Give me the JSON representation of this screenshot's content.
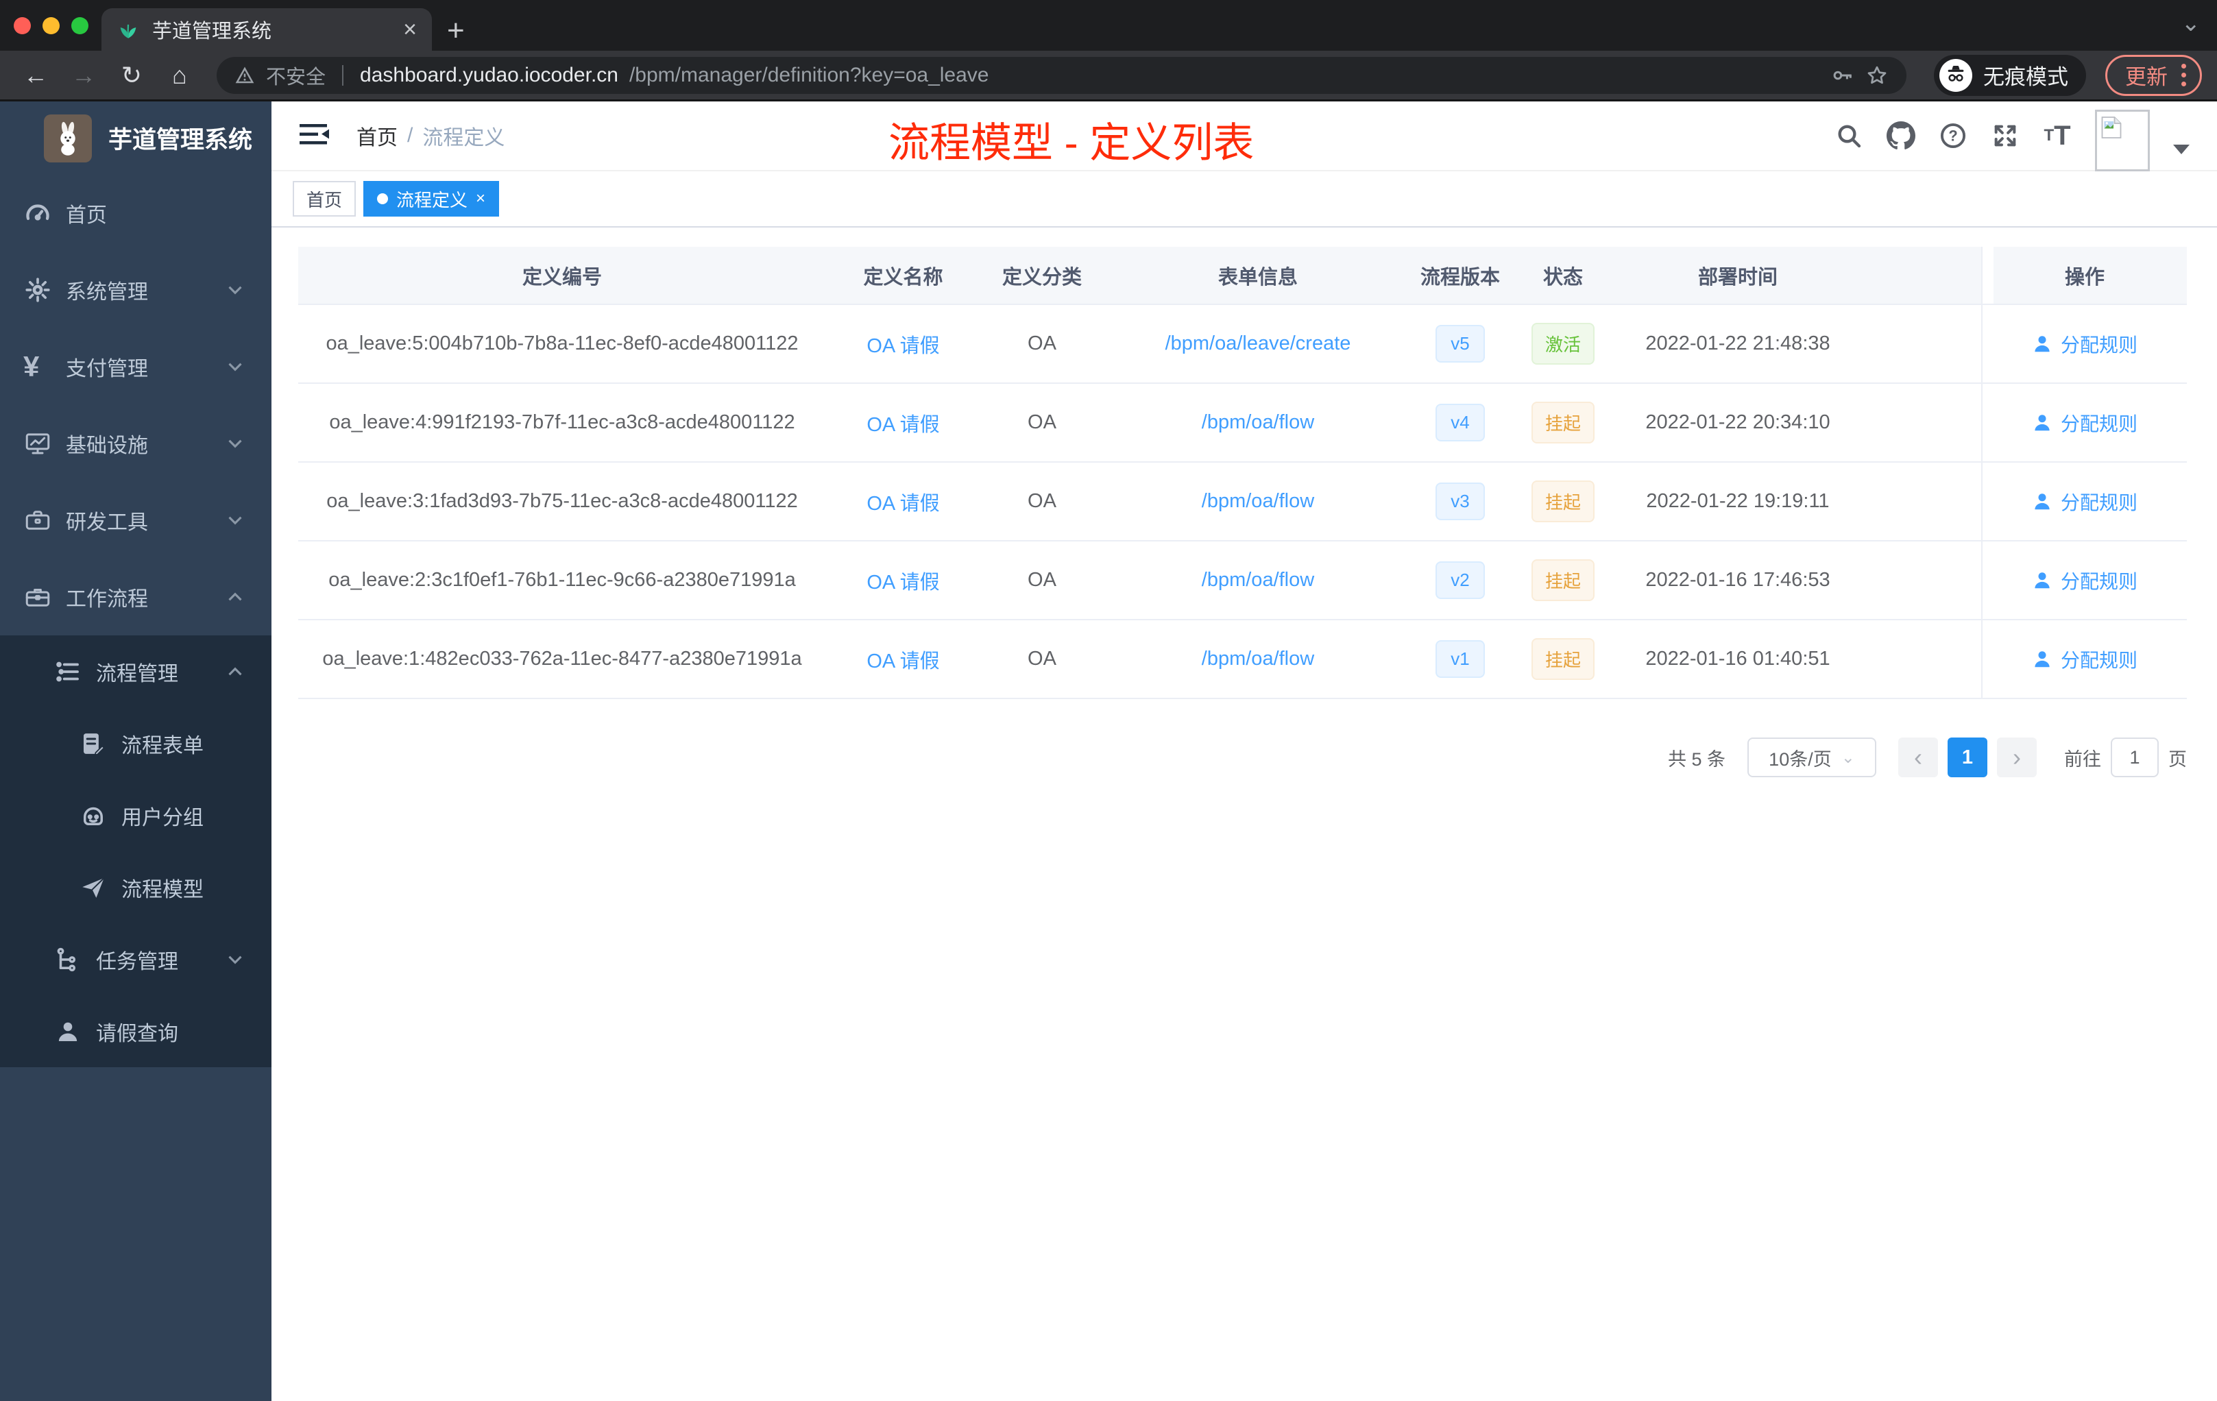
{
  "colors": {
    "primary_link": "#409eff",
    "active_tag": "#2190f0",
    "success": "#67c23a",
    "warning": "#e6a23c",
    "annotation_red": "#fe2c0a",
    "sidebar_bg": "#304156",
    "sidebar_submenu_bg": "#1f2d3d",
    "update_button": "#f28b82",
    "traffic_red": "#ff5f57",
    "traffic_yellow": "#febc2e",
    "traffic_green": "#28c840"
  },
  "icons": {
    "back": "←",
    "forward": "→",
    "reload": "↻",
    "home": "⌂",
    "close": "×",
    "plus": "+",
    "tab_search_caret": "⌄",
    "yen": "¥",
    "help": "?",
    "size_small": "T",
    "size_large": "T",
    "chevron_left": "‹",
    "chevron_right": "›",
    "select_caret": "⌄"
  },
  "browser": {
    "tab_title": "芋道管理系统",
    "security_label": "不安全",
    "url_host": "dashboard.yudao.iocoder.cn",
    "url_path": "/bpm/manager/definition?key=oa_leave",
    "incognito_label": "无痕模式",
    "update_label": "更新"
  },
  "sidebar": {
    "title": "芋道管理系统",
    "items": [
      {
        "label": "首页",
        "icon": "dashboard-icon"
      },
      {
        "label": "系统管理",
        "icon": "gear-icon",
        "chevron": "down"
      },
      {
        "label": "支付管理",
        "icon": "yen-icon",
        "chevron": "down"
      },
      {
        "label": "基础设施",
        "icon": "monitor-icon",
        "chevron": "down"
      },
      {
        "label": "研发工具",
        "icon": "toolbox-icon",
        "chevron": "down"
      },
      {
        "label": "工作流程",
        "icon": "briefcase-icon",
        "chevron": "up"
      },
      {
        "label": "流程管理",
        "icon": "list-tree-icon",
        "chevron": "up",
        "level": 2
      },
      {
        "label": "流程表单",
        "icon": "form-doc-icon",
        "level": 3
      },
      {
        "label": "用户分组",
        "icon": "robot-icon",
        "level": 3
      },
      {
        "label": "流程模型",
        "icon": "paper-plane-icon",
        "level": 3
      },
      {
        "label": "任务管理",
        "icon": "tree-icon",
        "chevron": "down",
        "level": 2
      },
      {
        "label": "请假查询",
        "icon": "person-icon",
        "level": 2
      }
    ]
  },
  "navbar": {
    "breadcrumb": {
      "home": "首页",
      "separator": "/",
      "current": "流程定义"
    },
    "annotation": "流程模型 - 定义列表"
  },
  "tags": [
    {
      "label": "首页",
      "active": false
    },
    {
      "label": "流程定义",
      "active": true
    }
  ],
  "table": {
    "headers": [
      "定义编号",
      "定义名称",
      "定义分类",
      "表单信息",
      "流程版本",
      "状态",
      "部署时间",
      "操作"
    ],
    "action_label": "分配规则",
    "rows": [
      {
        "id": "oa_leave:5:004b710b-7b8a-11ec-8ef0-acde48001122",
        "name": "OA 请假",
        "category": "OA",
        "form": "/bpm/oa/leave/create",
        "version": "v5",
        "status": "激活",
        "status_type": "success",
        "time": "2022-01-22 21:48:38",
        "action": "分配规则"
      },
      {
        "id": "oa_leave:4:991f2193-7b7f-11ec-a3c8-acde48001122",
        "name": "OA 请假",
        "category": "OA",
        "form": "/bpm/oa/flow",
        "version": "v4",
        "status": "挂起",
        "status_type": "warning",
        "time": "2022-01-22 20:34:10",
        "action": "分配规则"
      },
      {
        "id": "oa_leave:3:1fad3d93-7b75-11ec-a3c8-acde48001122",
        "name": "OA 请假",
        "category": "OA",
        "form": "/bpm/oa/flow",
        "version": "v3",
        "status": "挂起",
        "status_type": "warning",
        "time": "2022-01-22 19:19:11",
        "action": "分配规则"
      },
      {
        "id": "oa_leave:2:3c1f0ef1-76b1-11ec-9c66-a2380e71991a",
        "name": "OA 请假",
        "category": "OA",
        "form": "/bpm/oa/flow",
        "version": "v2",
        "status": "挂起",
        "status_type": "warning",
        "time": "2022-01-16 17:46:53",
        "action": "分配规则"
      },
      {
        "id": "oa_leave:1:482ec033-762a-11ec-8477-a2380e71991a",
        "name": "OA 请假",
        "category": "OA",
        "form": "/bpm/oa/flow",
        "version": "v1",
        "status": "挂起",
        "status_type": "warning",
        "time": "2022-01-16 01:40:51",
        "action": "分配规则"
      }
    ]
  },
  "pagination": {
    "total_label": "共 5 条",
    "page_size": "10条/页",
    "current_page": "1",
    "goto_label": "前往",
    "goto_value": "1",
    "page_unit": "页"
  }
}
